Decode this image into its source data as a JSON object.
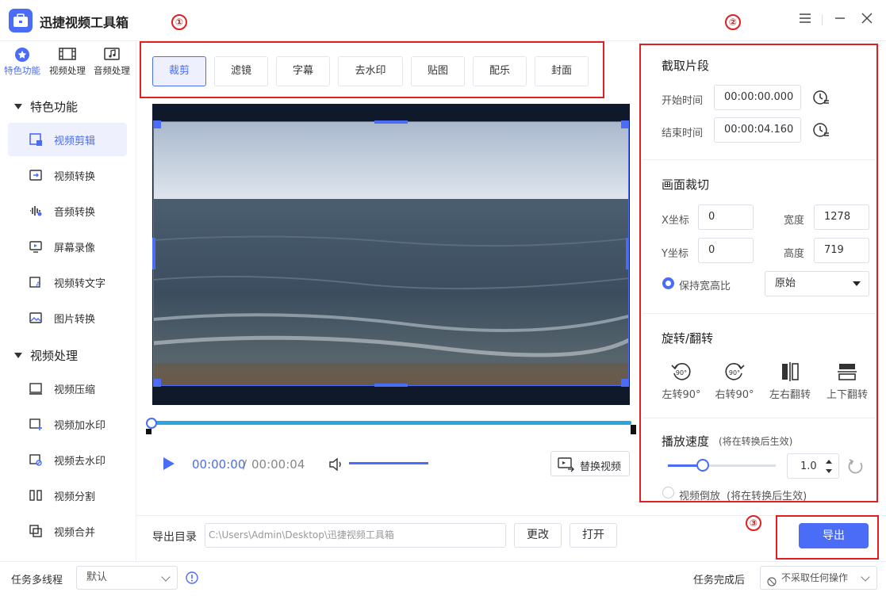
{
  "app": {
    "title": "迅捷视频工具箱"
  },
  "window": {
    "menu_icon": "menu-icon",
    "minimize_icon": "minimize-icon",
    "close_icon": "close-icon"
  },
  "topnav": [
    {
      "label": "特色功能",
      "icon": "star-icon",
      "active": true
    },
    {
      "label": "视频处理",
      "icon": "film-icon",
      "active": false
    },
    {
      "label": "音频处理",
      "icon": "music-icon",
      "active": false
    }
  ],
  "sidebar": {
    "section1": "特色功能",
    "items1": [
      {
        "label": "视频剪辑",
        "icon": "video-crop-icon",
        "active": true
      },
      {
        "label": "视频转换",
        "icon": "video-convert-icon"
      },
      {
        "label": "音频转换",
        "icon": "audio-wave-icon"
      },
      {
        "label": "屏幕录像",
        "icon": "screen-record-icon"
      },
      {
        "label": "视频转文字",
        "icon": "video-to-text-icon"
      },
      {
        "label": "图片转换",
        "icon": "image-convert-icon"
      }
    ],
    "section2": "视频处理",
    "items2": [
      {
        "label": "视频压缩",
        "icon": "compress-icon"
      },
      {
        "label": "视频加水印",
        "icon": "add-watermark-icon"
      },
      {
        "label": "视频去水印",
        "icon": "remove-watermark-icon"
      },
      {
        "label": "视频分割",
        "icon": "split-icon"
      },
      {
        "label": "视频合并",
        "icon": "merge-icon"
      }
    ]
  },
  "tools": [
    "裁剪",
    "滤镜",
    "字幕",
    "去水印",
    "贴图",
    "配乐",
    "封面"
  ],
  "markers": [
    "①",
    "②",
    "③"
  ],
  "player": {
    "current": "00:00:00",
    "separator": "/",
    "total": "00:00:04",
    "replace_label": "替换视频",
    "progress": 0
  },
  "clip": {
    "title": "截取片段",
    "start_label": "开始时间",
    "start_value": "00:00:00.000",
    "end_label": "结束时间",
    "end_value": "00:00:04.160"
  },
  "crop": {
    "title": "画面裁切",
    "x_label": "X坐标",
    "x_value": "0",
    "y_label": "Y坐标",
    "y_value": "0",
    "w_label": "宽度",
    "w_value": "1278",
    "h_label": "高度",
    "h_value": "719",
    "keep_ratio_label": "保持宽高比",
    "ratio_value": "原始"
  },
  "rotate": {
    "title": "旋转/翻转",
    "items": [
      "左转90°",
      "右转90°",
      "左右翻转",
      "上下翻转"
    ],
    "badge": "90°"
  },
  "speed": {
    "title": "播放速度",
    "note": "(将在转换后生效)",
    "value": "1.0",
    "reverse_label": "视频倒放",
    "reverse_note": "(将在转换后生效)"
  },
  "export": {
    "label": "导出目录",
    "path": "C:\\Users\\Admin\\Desktop\\迅捷视频工具箱",
    "change_label": "更改",
    "open_label": "打开",
    "export_label": "导出"
  },
  "footer": {
    "threads_label": "任务多线程",
    "threads_value": "默认",
    "after_label": "任务完成后",
    "after_value": "不采取任何操作"
  },
  "colors": {
    "accent": "#4a6cf7",
    "annotation": "#e02020",
    "timeline": "#2aa6dc"
  }
}
